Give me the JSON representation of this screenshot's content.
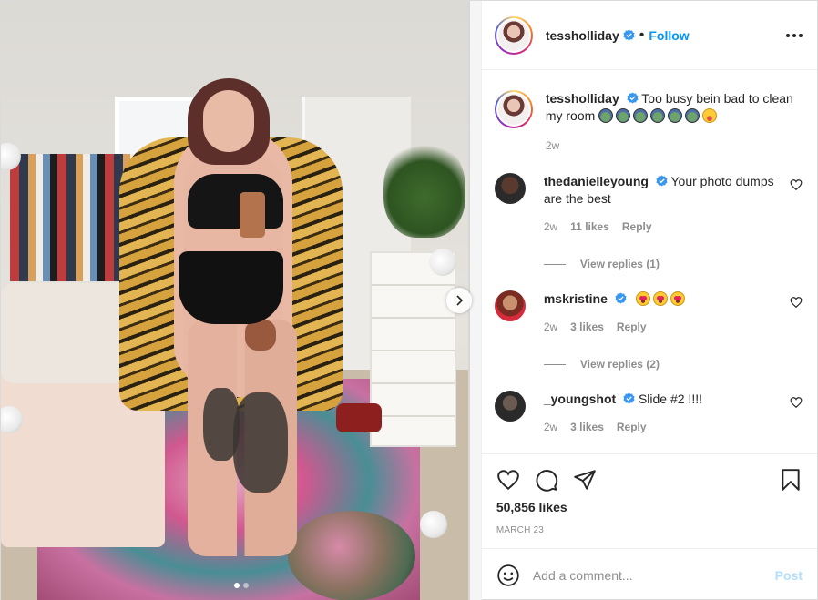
{
  "post": {
    "author": "tessholliday",
    "follow_label": "Follow",
    "separator": "•",
    "caption": {
      "username": "tessholliday",
      "text": "Too busy bein bad to clean my room",
      "emojis": [
        "pepe",
        "pepe",
        "pepe",
        "pepe",
        "pepe",
        "pepe",
        "tongue"
      ],
      "time": "2w"
    },
    "comments": [
      {
        "username": "thedanielleyoung",
        "verified": true,
        "text": "Your photo dumps are the best",
        "time": "2w",
        "likes": "11 likes",
        "reply_label": "Reply",
        "view_replies": "View replies (1)"
      },
      {
        "username": "mskristine",
        "verified": true,
        "text": "",
        "emojis": [
          "heart-eyes",
          "heart-eyes",
          "heart-eyes"
        ],
        "time": "2w",
        "likes": "3 likes",
        "reply_label": "Reply",
        "view_replies": "View replies (2)"
      },
      {
        "username": "_youngshot",
        "verified": true,
        "text": "Slide #2 !!!!",
        "time": "2w",
        "likes": "3 likes",
        "reply_label": "Reply"
      }
    ],
    "likes": "50,856 likes",
    "date": "MARCH 23",
    "add_comment_placeholder": "Add a comment...",
    "post_label": "Post",
    "carousel": {
      "slide_count": 2,
      "active_index": 0
    }
  },
  "colors": {
    "link_blue": "#0095f6",
    "verified_blue": "#3897f0",
    "muted": "#8e8e8e",
    "post_disabled": "#b2dffc"
  },
  "icons": [
    "verified-badge-icon",
    "more-options-icon",
    "heart-icon",
    "comment-icon",
    "share-icon",
    "bookmark-icon",
    "emoji-icon",
    "chevron-right-icon"
  ]
}
